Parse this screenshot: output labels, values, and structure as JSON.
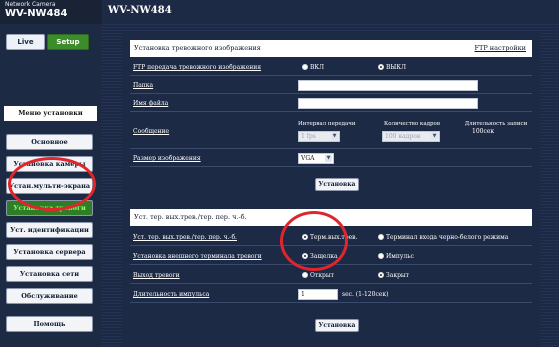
{
  "header": {
    "brand_small": "Network Camera",
    "brand_model": "WV-NW484",
    "model_title": "WV-NW484"
  },
  "nav": {
    "live_label": "Live",
    "setup_label": "Setup",
    "menu_title": "Меню установки",
    "items": [
      {
        "label": "Основное"
      },
      {
        "label": "Установка камеры"
      },
      {
        "label": "Устан.мульти-экрана"
      },
      {
        "label": "Установка тревоги"
      },
      {
        "label": "Уст. идентификации"
      },
      {
        "label": "Установка сервера"
      },
      {
        "label": "Установка сети"
      },
      {
        "label": "Обслуживание"
      },
      {
        "label": "Помощь"
      }
    ],
    "active_index": 3
  },
  "alarm_image": {
    "section_title": "Установка тревожного изображения",
    "ftp_link": "FTP настройки",
    "rows": {
      "ftp_transfer": {
        "label": "FTP передача тревожного изображения",
        "on": "ВКЛ",
        "off": "ВЫКЛ",
        "selected": "off"
      },
      "folder": {
        "label": "Папка",
        "value": ""
      },
      "filename": {
        "label": "Имя файла",
        "value": ""
      },
      "message": {
        "label": "Сообщение",
        "col_interval": "Интервал передачи",
        "col_count": "Количество кадров",
        "col_duration": "Длительность записи",
        "interval_value": "1 fps",
        "count_value": "100 кадров",
        "duration_value": "100сек"
      },
      "image_size": {
        "label": "Размер изображения",
        "value": "VGA"
      }
    },
    "apply_label": "Установка"
  },
  "alarm_output": {
    "section_title": "Уст. тер. вых.трев./тер. пер. ч.-б.",
    "rows": {
      "terminal": {
        "label": "Уст. тер. вых.трев./тер. пер. ч.-б.",
        "opt1": "Терм.вых.трев.",
        "opt2": "Терминал входа черно-белого режима",
        "selected": "opt1"
      },
      "terminal_setup": {
        "label": "Установка внешнего терминала тревоги",
        "opt1": "Защелка",
        "opt2": "Импульс",
        "selected": "opt1"
      },
      "alarm_output": {
        "label": "Выход тревоги",
        "opt1": "Открыт",
        "opt2": "Закрыт",
        "selected": "opt2"
      },
      "pulse_duration": {
        "label": "Длительность импульса",
        "value": "1",
        "suffix": "sec. (1-120сек)"
      }
    },
    "apply_label": "Установка"
  },
  "colors": {
    "accent_green": "#3c8c2c",
    "annotation_red": "#e0262c",
    "navy": "#1d2a45"
  }
}
